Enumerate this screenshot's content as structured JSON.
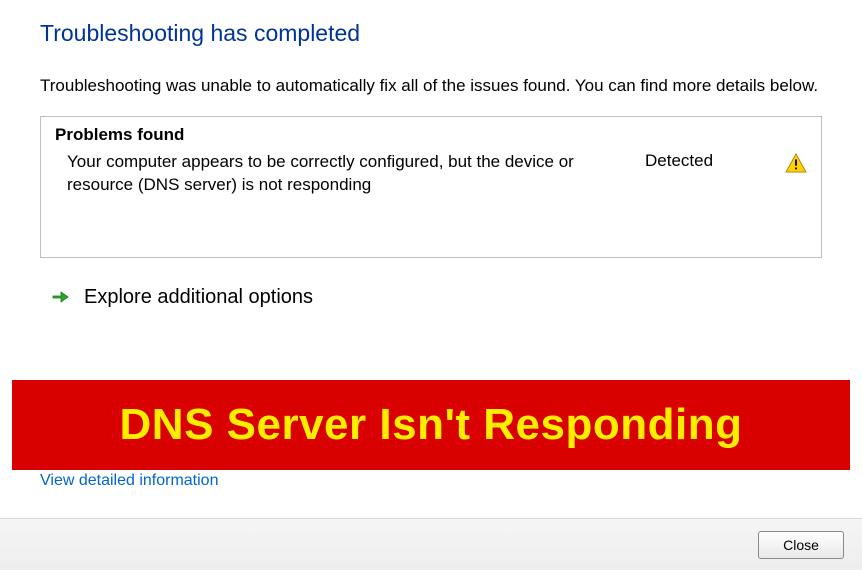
{
  "heading": "Troubleshooting has completed",
  "subtext": "Troubleshooting was unable to automatically fix all of the issues found. You can find more details below.",
  "problems": {
    "title": "Problems found",
    "items": [
      {
        "description": "Your computer appears to be correctly configured, but the device or resource (DNS server) is not responding",
        "status": "Detected"
      }
    ]
  },
  "explore_label": "Explore additional options",
  "banner_text": "DNS Server Isn't Responding",
  "view_details_link": "View detailed information",
  "close_button": "Close"
}
